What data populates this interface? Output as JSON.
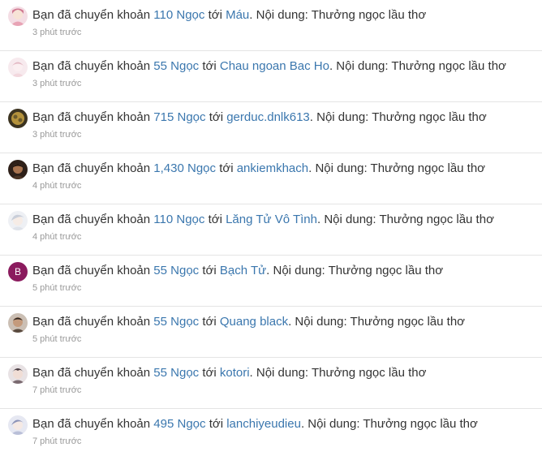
{
  "transfers": [
    {
      "prefix": "Bạn đã chuyển khoản",
      "amount": "110 Ngọc",
      "to_word": "tới",
      "recipient": "Máu",
      "content": ". Nội dung: Thưởng ngọc lầu thơ",
      "time": "3 phút trước",
      "avatar": "anime-girl-pink-avatar",
      "avatar_color": "#e8a3b5"
    },
    {
      "prefix": "Bạn đã chuyển khoản",
      "amount": "55 Ngọc",
      "to_word": "tới",
      "recipient": "Chau ngoan Bac Ho",
      "content": ". Nội dung: Thưởng ngọc lầu thơ",
      "time": "3 phút trước",
      "avatar": "light-pink-avatar",
      "avatar_color": "#f2d7dd"
    },
    {
      "prefix": "Bạn đã chuyển khoản",
      "amount": "715 Ngọc",
      "to_word": "tới",
      "recipient": "gerduc.dnlk613",
      "content": ". Nội dung: Thưởng ngọc lầu thơ",
      "time": "3 phút trước",
      "avatar": "golden-dark-avatar",
      "avatar_color": "#6b5a2c"
    },
    {
      "prefix": "Bạn đã chuyển khoản",
      "amount": "1,430 Ngọc",
      "to_word": "tới",
      "recipient": "ankiemkhach",
      "content": ". Nội dung: Thưởng ngọc lầu thơ",
      "time": "4 phút trước",
      "avatar": "dark-portrait-avatar",
      "avatar_color": "#4a3324"
    },
    {
      "prefix": "Bạn đã chuyển khoản",
      "amount": "110 Ngọc",
      "to_word": "tới",
      "recipient": "Lăng Tử Vô Tình",
      "content": ". Nội dung: Thưởng ngọc lầu thơ",
      "time": "4 phút trước",
      "avatar": "white-hair-avatar",
      "avatar_color": "#dfe3ea"
    },
    {
      "prefix": "Bạn đã chuyển khoản",
      "amount": "55 Ngọc",
      "to_word": "tới",
      "recipient": "Bạch Tử",
      "content": ". Nội dung: Thưởng ngọc lầu thơ",
      "time": "5 phút trước",
      "avatar": "letter-b-avatar",
      "avatar_letter": "B",
      "avatar_color": "#8b1b5e"
    },
    {
      "prefix": "Bạn đã chuyển khoản",
      "amount": "55 Ngọc",
      "to_word": "tới",
      "recipient": "Quang black",
      "content": ". Nội dung: Thưởng ngọc lầu thơ",
      "time": "5 phút trước",
      "avatar": "man-portrait-avatar",
      "avatar_color": "#5a4a3e"
    },
    {
      "prefix": "Bạn đã chuyển khoản",
      "amount": "55 Ngọc",
      "to_word": "tới",
      "recipient": "kotori",
      "content": ". Nội dung: Thưởng ngọc lầu thơ",
      "time": "7 phút trước",
      "avatar": "anime-boy-avatar",
      "avatar_color": "#7a6a70"
    },
    {
      "prefix": "Bạn đã chuyển khoản",
      "amount": "495 Ngọc",
      "to_word": "tới",
      "recipient": "lanchiyeudieu",
      "content": ". Nội dung: Thưởng ngọc lầu thơ",
      "time": "7 phút trước",
      "avatar": "anime-girl-blue-avatar",
      "avatar_color": "#b9bfd8"
    }
  ]
}
